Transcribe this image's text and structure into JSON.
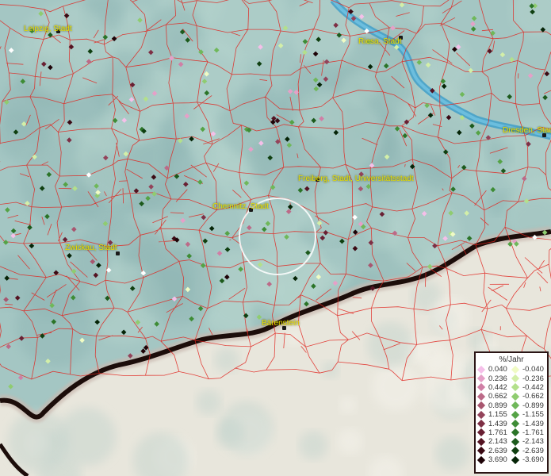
{
  "map": {
    "cities": [
      {
        "name": "Leipzig, Stadt"
      },
      {
        "name": "Riesa, Stadt"
      },
      {
        "name": "Dresden, Stadt"
      },
      {
        "name": "Freiberg, Stadt, Universitätsstadt"
      },
      {
        "name": "Chemnitz, Stadt"
      },
      {
        "name": "Zwickau, Stadt"
      },
      {
        "name": "Bärenstein"
      }
    ]
  },
  "legend": {
    "title": "%/Jahr",
    "positive": [
      {
        "label": "0.040",
        "color": "#f5bfe9"
      },
      {
        "label": "0.236",
        "color": "#e5a0c8"
      },
      {
        "label": "0.442",
        "color": "#d07fa6"
      },
      {
        "label": "0.662",
        "color": "#bc6a88"
      },
      {
        "label": "0.899",
        "color": "#a8566f"
      },
      {
        "label": "1.155",
        "color": "#93435a"
      },
      {
        "label": "1.439",
        "color": "#7e2f45"
      },
      {
        "label": "1.761",
        "color": "#692033"
      },
      {
        "label": "2.143",
        "color": "#541322"
      },
      {
        "label": "2.639",
        "color": "#3b0a14"
      },
      {
        "label": "3.690",
        "color": "#1e0307"
      }
    ],
    "negative": [
      {
        "label": "-0.040",
        "color": "#f0fbc4"
      },
      {
        "label": "-0.236",
        "color": "#d3efa8"
      },
      {
        "label": "-0.442",
        "color": "#b3e08b"
      },
      {
        "label": "-0.662",
        "color": "#8fcc70"
      },
      {
        "label": "-0.899",
        "color": "#6fb85a"
      },
      {
        "label": "-1.155",
        "color": "#55a346"
      },
      {
        "label": "-1.439",
        "color": "#3e8c36"
      },
      {
        "label": "-1.761",
        "color": "#2b7428"
      },
      {
        "label": "-2.143",
        "color": "#1c5a1c"
      },
      {
        "label": "-2.639",
        "color": "#0f3f10"
      },
      {
        "label": "-3.690",
        "color": "#052407"
      }
    ]
  }
}
